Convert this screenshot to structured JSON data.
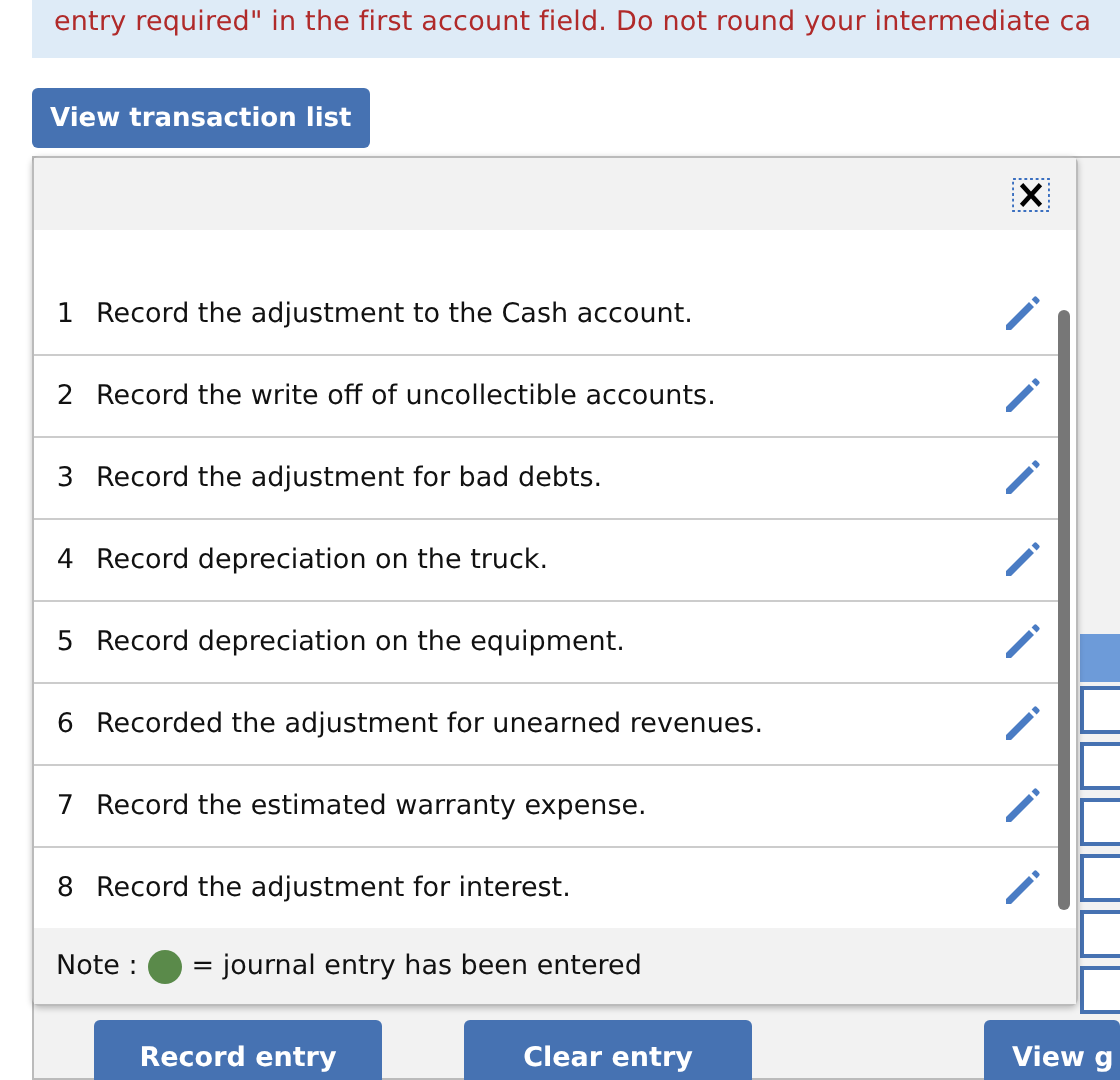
{
  "instructions": "entry required\" in the first account field. Do not round your intermediate ca",
  "view_button": "View transaction list",
  "transactions": [
    {
      "number": "1",
      "text": "Record the adjustment to the Cash account."
    },
    {
      "number": "2",
      "text": "Record the write off of uncollectible accounts."
    },
    {
      "number": "3",
      "text": "Record the adjustment for bad debts."
    },
    {
      "number": "4",
      "text": "Record depreciation on the truck."
    },
    {
      "number": "5",
      "text": "Record depreciation on the equipment."
    },
    {
      "number": "6",
      "text": "Recorded the adjustment for unearned revenues."
    },
    {
      "number": "7",
      "text": "Record the estimated warranty expense."
    },
    {
      "number": "8",
      "text": "Record the adjustment for interest."
    }
  ],
  "note": {
    "label": "Note :",
    "color": "#5a8a4a",
    "text": "= journal entry has been entered"
  },
  "buttons": [
    "Record entry",
    "Clear entry",
    "View g"
  ]
}
